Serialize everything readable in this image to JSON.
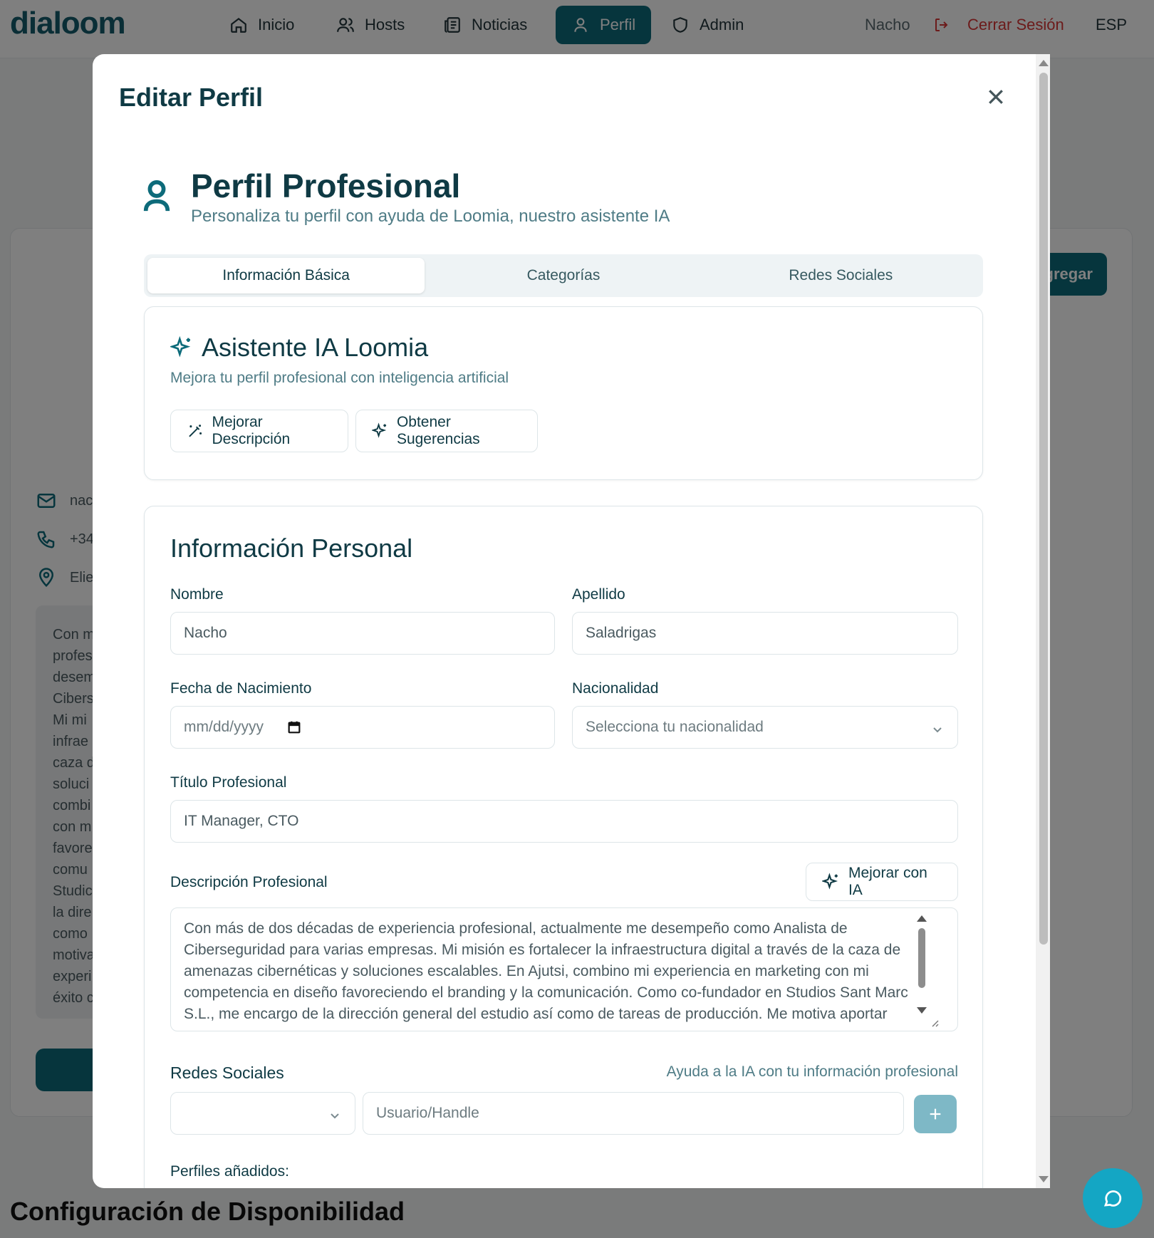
{
  "app": {
    "logo": "dialoom"
  },
  "nav": {
    "items": [
      {
        "label": "Inicio",
        "icon": "home-icon"
      },
      {
        "label": "Hosts",
        "icon": "users-icon"
      },
      {
        "label": "Noticias",
        "icon": "newspaper-icon"
      },
      {
        "label": "Perfil",
        "icon": "user-icon",
        "active": true
      },
      {
        "label": "Admin",
        "icon": "shield-icon"
      }
    ],
    "user_name": "Nacho",
    "logout_label": "Cerrar Sesión",
    "language": "ESP"
  },
  "background": {
    "add_button": "gregar",
    "contact": {
      "email": "nac",
      "phone": "+34",
      "location": "Elie"
    },
    "bio_lines": [
      "Con m",
      "profes",
      "desem",
      "Cibers",
      "Mi mi",
      "infrae",
      "caza d",
      "soluci",
      "combi",
      "con m",
      "favore",
      "comu",
      "Studic",
      "la dire",
      "como",
      "motiva",
      "experi",
      "éxito c"
    ],
    "section_title": "Configuración de Disponibilidad"
  },
  "modal": {
    "title": "Editar Perfil",
    "header": {
      "title": "Perfil Profesional",
      "subtitle": "Personaliza tu perfil con ayuda de Loomia, nuestro asistente IA"
    },
    "tabs": [
      {
        "label": "Información Básica",
        "active": true
      },
      {
        "label": "Categorías"
      },
      {
        "label": "Redes Sociales"
      }
    ],
    "ai_assistant": {
      "title": "Asistente IA Loomia",
      "subtitle": "Mejora tu perfil profesional con inteligencia artificial",
      "improve_button": "Mejorar Descripción",
      "suggestions_button": "Obtener Sugerencias"
    },
    "personal_info": {
      "title": "Información Personal",
      "first_name_label": "Nombre",
      "first_name_value": "Nacho",
      "last_name_label": "Apellido",
      "last_name_value": "Saladrigas",
      "birthdate_label": "Fecha de Nacimiento",
      "birthdate_placeholder": "mm/dd/yyyy",
      "nationality_label": "Nacionalidad",
      "nationality_placeholder": "Selecciona tu nacionalidad",
      "job_title_label": "Título Profesional",
      "job_title_value": "IT Manager, CTO",
      "description_label": "Descripción Profesional",
      "improve_ai_button": "Mejorar con IA",
      "description_value": "Con más de dos décadas de experiencia profesional, actualmente me desempeño como Analista de Ciberseguridad para varias empresas. Mi misión es fortalecer la infraestructura digital a través de la caza de amenazas cibernéticas y soluciones escalables. En Ajutsi, combino mi experiencia en marketing con mi competencia en diseño favoreciendo el branding y la comunicación. Como co-fundador en Studios Sant Marc S.L., me encargo de la dirección general del estudio así como de tareas de producción. Me motiva aportar",
      "social_label": "Redes Sociales",
      "social_hint": "Ayuda a la IA con tu información profesional",
      "handle_placeholder": "Usuario/Handle",
      "added_profiles_label": "Perfiles añadidos:"
    }
  },
  "colors": {
    "primary": "#0d6b7a",
    "heading": "#0f3a44",
    "muted": "#4f7c86",
    "danger": "#d93636",
    "chat_fab": "#14a6c4"
  }
}
